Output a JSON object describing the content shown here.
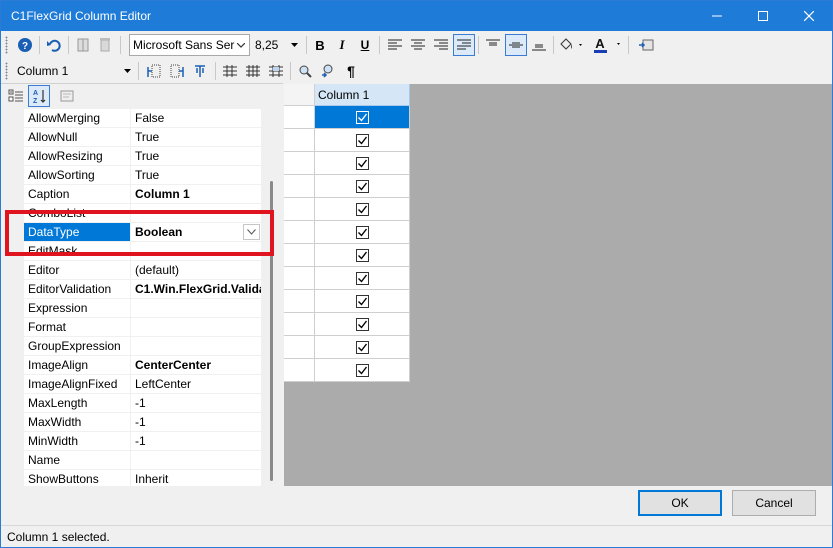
{
  "window": {
    "title": "C1FlexGrid Column Editor",
    "controls": [
      "minimize-icon",
      "maximize-icon",
      "close-icon"
    ]
  },
  "toolbar1": {
    "font_name": "Microsoft Sans Ser",
    "font_size": "8,25",
    "bold": "B",
    "italic": "I",
    "underline": "U"
  },
  "toolbar2": {
    "column_select": "Column 1",
    "pilcrow": "¶"
  },
  "properties": [
    {
      "name": "AllowMerging",
      "value": "False",
      "bold": false
    },
    {
      "name": "AllowNull",
      "value": "True",
      "bold": false
    },
    {
      "name": "AllowResizing",
      "value": "True",
      "bold": false
    },
    {
      "name": "AllowSorting",
      "value": "True",
      "bold": false
    },
    {
      "name": "Caption",
      "value": "Column 1",
      "bold": true
    },
    {
      "name": "ComboList",
      "value": "",
      "bold": false
    },
    {
      "name": "DataType",
      "value": "Boolean",
      "bold": true,
      "selected": true
    },
    {
      "name": "EditMask",
      "value": "",
      "bold": false
    },
    {
      "name": "Editor",
      "value": "(default)",
      "bold": false
    },
    {
      "name": "EditorValidation",
      "value": "C1.Win.FlexGrid.Valida",
      "bold": true
    },
    {
      "name": "Expression",
      "value": "",
      "bold": false
    },
    {
      "name": "Format",
      "value": "",
      "bold": false
    },
    {
      "name": "GroupExpression",
      "value": "",
      "bold": false
    },
    {
      "name": "ImageAlign",
      "value": "CenterCenter",
      "bold": true
    },
    {
      "name": "ImageAlignFixed",
      "value": "LeftCenter",
      "bold": false
    },
    {
      "name": "MaxLength",
      "value": "-1",
      "bold": false
    },
    {
      "name": "MaxWidth",
      "value": "-1",
      "bold": false
    },
    {
      "name": "MinWidth",
      "value": "-1",
      "bold": false
    },
    {
      "name": "Name",
      "value": "",
      "bold": false
    },
    {
      "name": "ShowButtons",
      "value": "Inherit",
      "bold": false
    }
  ],
  "grid": {
    "column_header": "Column 1",
    "rows": [
      true,
      true,
      true,
      true,
      true,
      true,
      true,
      true,
      true,
      true,
      true,
      true
    ]
  },
  "buttons": {
    "ok": "OK",
    "cancel": "Cancel"
  },
  "status": {
    "text": "Column 1 selected."
  },
  "colors": {
    "title_bar": "#1e7bd8",
    "selection": "#0078d7",
    "highlight_box": "#e0141e",
    "grid_background": "#ababab"
  }
}
